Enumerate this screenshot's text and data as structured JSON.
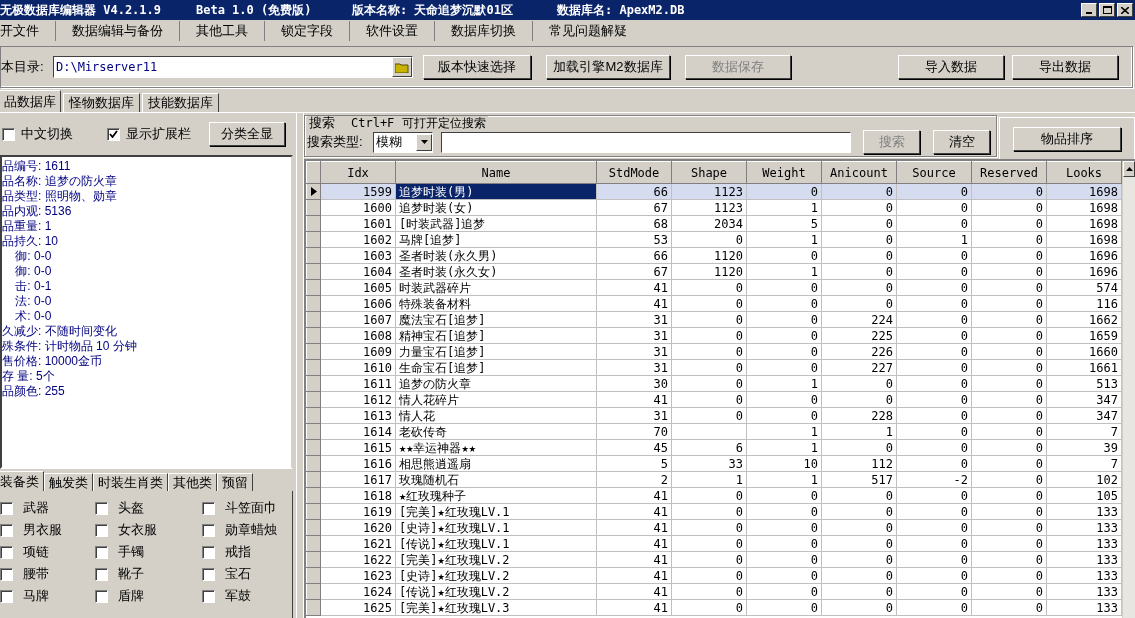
{
  "window": {
    "title": "无极数据库编辑器 V4.2.1.9",
    "edition": "Beta 1.0 (免费版)",
    "version_name": "版本名称: 天命追梦沉默01区",
    "database_name": "数据库名: ApexM2.DB"
  },
  "menu": [
    "开文件",
    "数据编辑与备份",
    "其他工具",
    "锁定字段",
    "软件设置",
    "数据库切换",
    "常见问题解疑"
  ],
  "toolbar": {
    "directory_label": "本目录:",
    "directory_value": "D:\\Mirserver11",
    "buttons": [
      {
        "label": "版本快速选择",
        "disabled": false
      },
      {
        "label": "加载引擎M2数据库",
        "disabled": false
      },
      {
        "label": "数据保存",
        "disabled": true
      },
      {
        "label": "导入数据",
        "disabled": false
      },
      {
        "label": "导出数据",
        "disabled": false
      }
    ]
  },
  "tabs": [
    {
      "label": "品数据库",
      "selected": true
    },
    {
      "label": "怪物数据库",
      "selected": false
    },
    {
      "label": "技能数据库",
      "selected": false
    }
  ],
  "options": {
    "checkboxes": [
      {
        "label": "中文切换",
        "checked": false
      },
      {
        "label": "显示扩展栏",
        "checked": true
      }
    ],
    "button": "分类全显"
  },
  "item_info": [
    "品编号: 1611",
    "品名称: 追梦の防火章",
    "品类型: 照明物、勋章",
    "品内观: 5136",
    "品重量: 1",
    "品持久: 10",
    "    御: 0-0",
    "    御: 0-0",
    "    击: 0-1",
    "    法: 0-0",
    "    术: 0-0",
    "久减少: 不随时间变化",
    "殊条件: 计时物品 10 分钟",
    "售价格: 10000金币",
    "存 量: 5个",
    "品颜色: 255"
  ],
  "category_tabs": [
    {
      "label": "装备类",
      "selected": true
    },
    {
      "label": "触发类",
      "selected": false
    },
    {
      "label": "时装生肖类",
      "selected": false
    },
    {
      "label": "其他类",
      "selected": false
    },
    {
      "label": "预留",
      "selected": false
    }
  ],
  "category_checks": [
    {
      "label": "武器",
      "checked": false
    },
    {
      "label": "头盔",
      "checked": false
    },
    {
      "label": "斗笠面巾",
      "checked": false
    },
    {
      "label": "男衣服",
      "checked": false
    },
    {
      "label": "女衣服",
      "checked": false
    },
    {
      "label": "勋章蜡烛",
      "checked": false
    },
    {
      "label": "项链",
      "checked": false
    },
    {
      "label": "手镯",
      "checked": false
    },
    {
      "label": "戒指",
      "checked": false
    },
    {
      "label": "腰带",
      "checked": false
    },
    {
      "label": "靴子",
      "checked": false
    },
    {
      "label": "宝石",
      "checked": false
    },
    {
      "label": "马牌",
      "checked": false
    },
    {
      "label": "盾牌",
      "checked": false
    },
    {
      "label": "军鼓",
      "checked": false
    }
  ],
  "search": {
    "title": "搜索",
    "hint": "Ctrl+F 可打开定位搜索",
    "type_label": "搜索类型:",
    "type_value": "模糊",
    "buttons": [
      {
        "label": "搜索",
        "disabled": true
      },
      {
        "label": "清空",
        "disabled": false
      }
    ]
  },
  "sort_button": "物品排序",
  "table": {
    "columns": [
      "Idx",
      "Name",
      "StdMode",
      "Shape",
      "Weight",
      "Anicount",
      "Source",
      "Reserved",
      "Looks"
    ],
    "rows": [
      {
        "selected": true,
        "cells": [
          "1599",
          "追梦时装(男)",
          "66",
          "1123",
          "0",
          "0",
          "0",
          "0",
          "1698"
        ]
      },
      {
        "selected": false,
        "cells": [
          "1600",
          "追梦时装(女)",
          "67",
          "1123",
          "1",
          "0",
          "0",
          "0",
          "1698"
        ]
      },
      {
        "selected": false,
        "cells": [
          "1601",
          "[时装武器]追梦",
          "68",
          "2034",
          "5",
          "0",
          "0",
          "0",
          "1698"
        ]
      },
      {
        "selected": false,
        "cells": [
          "1602",
          "马牌[追梦]",
          "53",
          "0",
          "1",
          "0",
          "1",
          "0",
          "1698"
        ]
      },
      {
        "selected": false,
        "cells": [
          "1603",
          "圣者时装(永久男)",
          "66",
          "1120",
          "0",
          "0",
          "0",
          "0",
          "1696"
        ]
      },
      {
        "selected": false,
        "cells": [
          "1604",
          "圣者时装(永久女)",
          "67",
          "1120",
          "1",
          "0",
          "0",
          "0",
          "1696"
        ]
      },
      {
        "selected": false,
        "cells": [
          "1605",
          "时装武器碎片",
          "41",
          "0",
          "0",
          "0",
          "0",
          "0",
          "574"
        ]
      },
      {
        "selected": false,
        "cells": [
          "1606",
          "特殊装备材料",
          "41",
          "0",
          "0",
          "0",
          "0",
          "0",
          "116"
        ]
      },
      {
        "selected": false,
        "cells": [
          "1607",
          "魔法宝石[追梦]",
          "31",
          "0",
          "0",
          "224",
          "0",
          "0",
          "1662"
        ]
      },
      {
        "selected": false,
        "cells": [
          "1608",
          "精神宝石[追梦]",
          "31",
          "0",
          "0",
          "225",
          "0",
          "0",
          "1659"
        ]
      },
      {
        "selected": false,
        "cells": [
          "1609",
          "力量宝石[追梦]",
          "31",
          "0",
          "0",
          "226",
          "0",
          "0",
          "1660"
        ]
      },
      {
        "selected": false,
        "cells": [
          "1610",
          "生命宝石[追梦]",
          "31",
          "0",
          "0",
          "227",
          "0",
          "0",
          "1661"
        ]
      },
      {
        "selected": false,
        "cells": [
          "1611",
          "追梦の防火章",
          "30",
          "0",
          "1",
          "0",
          "0",
          "0",
          "513"
        ]
      },
      {
        "selected": false,
        "cells": [
          "1612",
          "情人花碎片",
          "41",
          "0",
          "0",
          "0",
          "0",
          "0",
          "347"
        ]
      },
      {
        "selected": false,
        "cells": [
          "1613",
          "情人花",
          "31",
          "0",
          "0",
          "228",
          "0",
          "0",
          "347"
        ]
      },
      {
        "selected": false,
        "cells": [
          "1614",
          "老砍传奇",
          "70",
          null,
          "1",
          "1",
          "0",
          "0",
          "7"
        ]
      },
      {
        "selected": false,
        "cells": [
          "1615",
          "★★幸运神器★★",
          "45",
          "6",
          "1",
          "0",
          "0",
          "0",
          "39"
        ]
      },
      {
        "selected": false,
        "cells": [
          "1616",
          "相思熊逍遥扇",
          "5",
          "33",
          "10",
          "112",
          "0",
          "0",
          "7"
        ]
      },
      {
        "selected": false,
        "cells": [
          "1617",
          "玫瑰随机石",
          "2",
          "1",
          "1",
          "517",
          "-2",
          "0",
          "102"
        ]
      },
      {
        "selected": false,
        "cells": [
          "1618",
          "★红玫瑰种子",
          "41",
          "0",
          "0",
          "0",
          "0",
          "0",
          "105"
        ]
      },
      {
        "selected": false,
        "cells": [
          "1619",
          "[完美]★红玫瑰LV.1",
          "41",
          "0",
          "0",
          "0",
          "0",
          "0",
          "133"
        ]
      },
      {
        "selected": false,
        "cells": [
          "1620",
          "[史诗]★红玫瑰LV.1",
          "41",
          "0",
          "0",
          "0",
          "0",
          "0",
          "133"
        ]
      },
      {
        "selected": false,
        "cells": [
          "1621",
          "[传说]★红玫瑰LV.1",
          "41",
          "0",
          "0",
          "0",
          "0",
          "0",
          "133"
        ]
      },
      {
        "selected": false,
        "cells": [
          "1622",
          "[完美]★红玫瑰LV.2",
          "41",
          "0",
          "0",
          "0",
          "0",
          "0",
          "133"
        ]
      },
      {
        "selected": false,
        "cells": [
          "1623",
          "[史诗]★红玫瑰LV.2",
          "41",
          "0",
          "0",
          "0",
          "0",
          "0",
          "133"
        ]
      },
      {
        "selected": false,
        "cells": [
          "1624",
          "[传说]★红玫瑰LV.2",
          "41",
          "0",
          "0",
          "0",
          "0",
          "0",
          "133"
        ]
      },
      {
        "selected": false,
        "cells": [
          "1625",
          "[完美]★红玫瑰LV.3",
          "41",
          "0",
          "0",
          "0",
          "0",
          "0",
          "133"
        ]
      }
    ]
  }
}
